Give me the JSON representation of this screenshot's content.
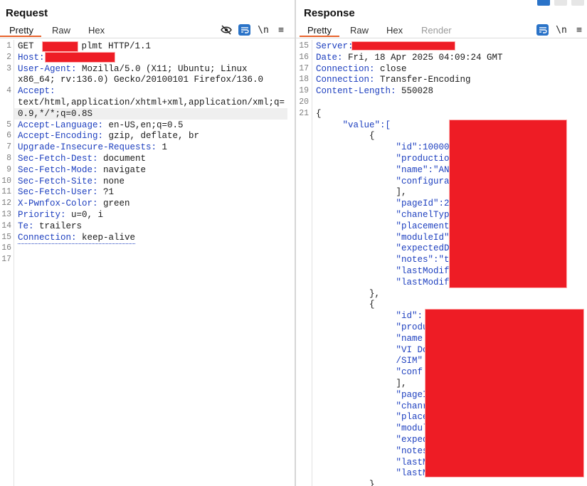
{
  "request": {
    "title": "Request",
    "tabs": [
      "Pretty",
      "Raw",
      "Hex"
    ],
    "tools": {
      "hide": "⦸",
      "wrap": "↵",
      "newline": "\\n",
      "menu": "≡"
    },
    "lines": [
      {
        "n": "1",
        "parts": [
          "GET ",
          "",
          " plmt HTTP/1.1"
        ]
      },
      {
        "n": "2",
        "key": "Host:",
        "val": " "
      },
      {
        "n": "3",
        "key": "User-Agent:",
        "val": " Mozilla/5.0 (X11; Ubuntu; Linux"
      },
      {
        "n": "",
        "val": "x86_64; rv:136.0) Gecko/20100101 Firefox/136.0"
      },
      {
        "n": "4",
        "key": "Accept:",
        "val": ""
      },
      {
        "n": "",
        "val": "text/html,application/xhtml+xml,application/xml;q="
      },
      {
        "n": "",
        "val": "0.9,*/*;q=0.8S"
      },
      {
        "n": "5",
        "key": "Accept-Language:",
        "val": " en-US,en;q=0.5"
      },
      {
        "n": "6",
        "key": "Accept-Encoding:",
        "val": " gzip, deflate, br"
      },
      {
        "n": "7",
        "key": "Upgrade-Insecure-Requests:",
        "val": " 1"
      },
      {
        "n": "8",
        "key": "Sec-Fetch-Dest:",
        "val": " document"
      },
      {
        "n": "9",
        "key": "Sec-Fetch-Mode:",
        "val": " navigate"
      },
      {
        "n": "10",
        "key": "Sec-Fetch-Site:",
        "val": " none"
      },
      {
        "n": "11",
        "key": "Sec-Fetch-User:",
        "val": " ?1"
      },
      {
        "n": "12",
        "key": "X-Pwnfox-Color:",
        "val": " green"
      },
      {
        "n": "13",
        "key": "Priority:",
        "val": " u=0, i"
      },
      {
        "n": "14",
        "key": "Te:",
        "val": " trailers"
      },
      {
        "n": "15",
        "key": "Connection:",
        "val": " keep-alive"
      },
      {
        "n": "16",
        "val": ""
      },
      {
        "n": "17",
        "val": ""
      }
    ]
  },
  "response": {
    "title": "Response",
    "tabs": [
      "Pretty",
      "Raw",
      "Hex",
      "Render"
    ],
    "tools": {
      "wrap": "↵",
      "newline": "\\n",
      "menu": "≡"
    },
    "lines": [
      {
        "n": "15",
        "key": "Server:",
        "val": " "
      },
      {
        "n": "16",
        "key": "Date:",
        "val": " Fri, 18 Apr 2025 04:09:24 GMT"
      },
      {
        "n": "17",
        "key": "Connection:",
        "val": " close"
      },
      {
        "n": "18",
        "key": "Connection:",
        "val": " Transfer-Encoding"
      },
      {
        "n": "19",
        "key": "Content-Length:",
        "val": " 550028"
      },
      {
        "n": "20",
        "val": ""
      },
      {
        "n": "21",
        "val": "{"
      },
      {
        "n": "",
        "val": "     \"value\":["
      },
      {
        "n": "",
        "val": "          {"
      },
      {
        "n": "",
        "val": "               \"id\":10000"
      },
      {
        "n": "",
        "val": "               \"productio"
      },
      {
        "n": "",
        "val": "               \"name\":\"AN"
      },
      {
        "n": "",
        "val": "               \"configura"
      },
      {
        "n": "",
        "val": "               ],"
      },
      {
        "n": "",
        "val": "               \"pageId\":2"
      },
      {
        "n": "",
        "val": "               \"chanelTyp"
      },
      {
        "n": "",
        "val": "               \"placement"
      },
      {
        "n": "",
        "val": "               \"moduleId\""
      },
      {
        "n": "",
        "val": "               \"expectedD"
      },
      {
        "n": "",
        "val": "               \"notes\":\"t"
      },
      {
        "n": "",
        "val": "               \"lastModif"
      },
      {
        "n": "",
        "val": "               \"lastModif"
      },
      {
        "n": "",
        "val": "          },"
      },
      {
        "n": "",
        "val": "          {"
      },
      {
        "n": "",
        "val": "               \"id\":"
      },
      {
        "n": "",
        "val": "               \"produ"
      },
      {
        "n": "",
        "val": "               \"name"
      },
      {
        "n": "",
        "val": "               \"VI Do"
      },
      {
        "n": "",
        "val": "               /SIM\""
      },
      {
        "n": "",
        "val": "               \"conf"
      },
      {
        "n": "",
        "val": "               ],"
      },
      {
        "n": "",
        "val": "               \"pageI"
      },
      {
        "n": "",
        "val": "               \"chanr"
      },
      {
        "n": "",
        "val": "               \"place"
      },
      {
        "n": "",
        "val": "               \"modul"
      },
      {
        "n": "",
        "val": "               \"exped"
      },
      {
        "n": "",
        "val": "               \"notes"
      },
      {
        "n": "",
        "val": "               \"lastM"
      },
      {
        "n": "",
        "val": "               \"lastM"
      },
      {
        "n": "",
        "val": "          }"
      }
    ]
  },
  "colors": {
    "accent": "#e8622c",
    "blue": "#2a73c8",
    "redaction": "#ee1c25",
    "key": "#1d3fbf"
  }
}
